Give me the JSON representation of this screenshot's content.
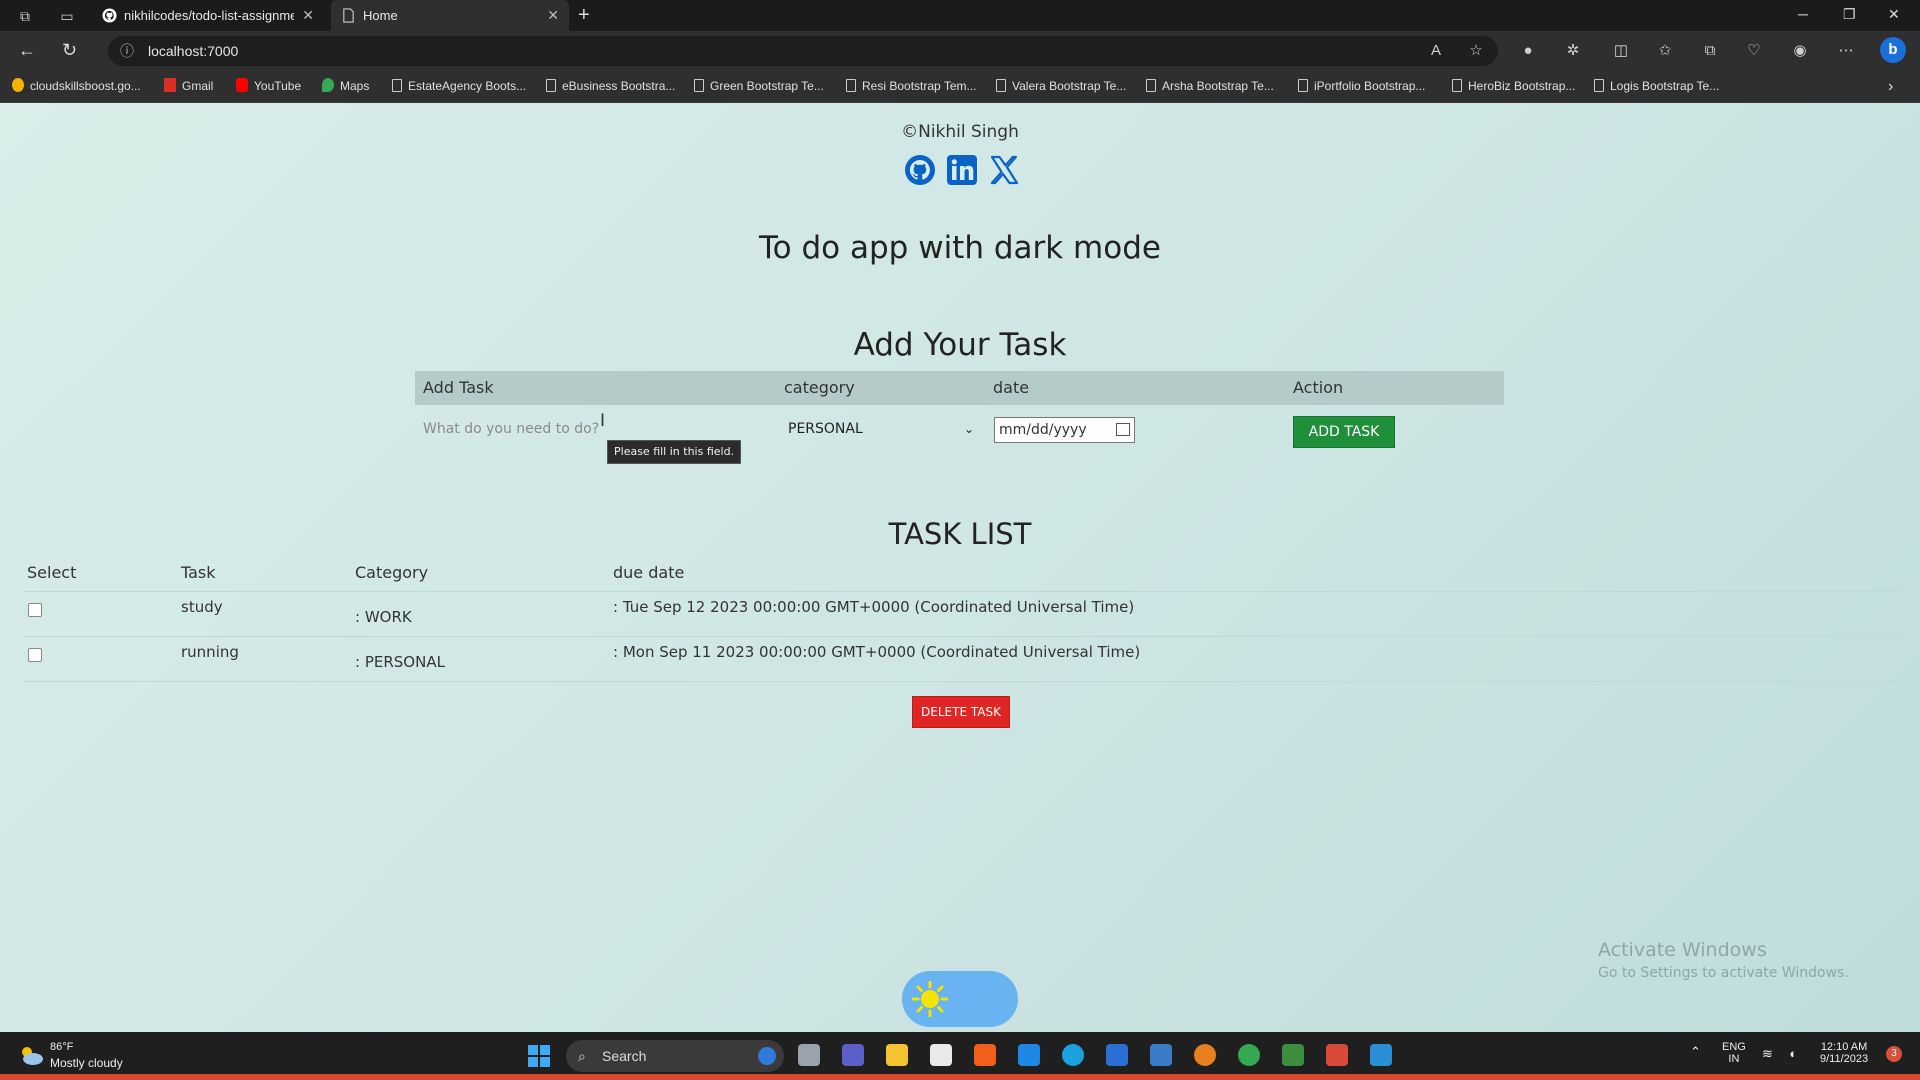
{
  "browser": {
    "tabs": [
      {
        "label": "nikhilcodes/todo-list-assignme",
        "active": false
      },
      {
        "label": "Home",
        "active": true
      }
    ],
    "url": "localhost:7000",
    "bookmarks": [
      "cloudskillsboost.go...",
      "Gmail",
      "YouTube",
      "Maps",
      "EstateAgency Boots...",
      "eBusiness Bootstra...",
      "Green Bootstrap Te...",
      "Resi Bootstrap Tem...",
      "Valera Bootstrap Te...",
      "Arsha Bootstrap Te...",
      "iPortfolio Bootstrap...",
      "HeroBiz Bootstrap...",
      "Logis Bootstrap Te..."
    ]
  },
  "page": {
    "copyright": "©Nikhil Singh",
    "social_icons": [
      "github-icon",
      "linkedin-icon",
      "x-icon"
    ],
    "app_title": "To do app with dark mode",
    "add_heading": "Add Your Task",
    "form": {
      "headers": {
        "task": "Add Task",
        "category": "category",
        "date": "date",
        "action": "Action"
      },
      "task_placeholder": "What do you need to do?",
      "tooltip": "Please fill in this field.",
      "category_value": "PERSONAL",
      "date_placeholder": "mm/dd/yyyy",
      "add_button": "ADD TASK"
    },
    "list_heading": "TASK LIST",
    "list": {
      "headers": {
        "select": "Select",
        "task": "Task",
        "category": "Category",
        "due": "due date"
      },
      "rows": [
        {
          "task": "study",
          "category": ": WORK",
          "due": ": Tue Sep 12 2023 00:00:00 GMT+0000 (Coordinated Universal Time)"
        },
        {
          "task": "running",
          "category": ": PERSONAL",
          "due": ": Mon Sep 11 2023 00:00:00 GMT+0000 (Coordinated Universal Time)"
        }
      ]
    },
    "delete_button": "DELETE TASK",
    "watermark": {
      "line1": "Activate Windows",
      "line2": "Go to Settings to activate Windows."
    }
  },
  "taskbar": {
    "weather_temp": "86°F",
    "weather_desc": "Mostly cloudy",
    "search": "Search",
    "lang_top": "ENG",
    "lang_bottom": "IN",
    "time": "12:10 AM",
    "date": "9/11/2023",
    "notification_count": "3"
  },
  "colors": {
    "add_button": "#1f8f3a",
    "delete_button": "#e02525",
    "toggle": "#68b3f0",
    "sun": "#f5e300"
  }
}
